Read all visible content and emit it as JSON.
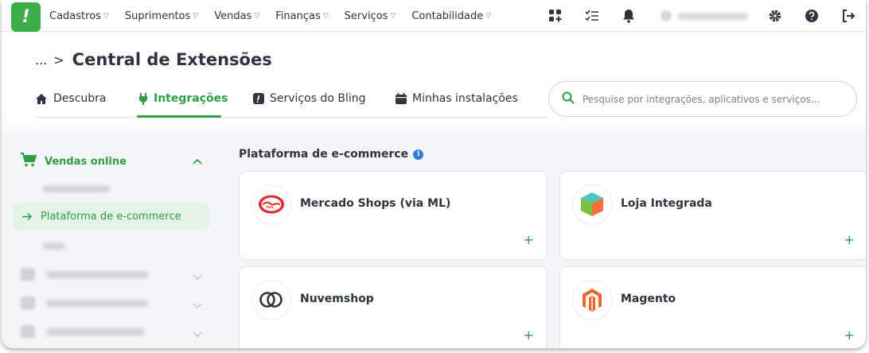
{
  "topnav": {
    "logo_glyph": "!",
    "menu": [
      {
        "label": "Cadastros"
      },
      {
        "label": "Suprimentos"
      },
      {
        "label": "Vendas"
      },
      {
        "label": "Finanças"
      },
      {
        "label": "Serviços"
      },
      {
        "label": "Contabilidade"
      }
    ],
    "icons": [
      "apps-plus-icon",
      "checklist-icon",
      "bell-icon",
      "gear-icon",
      "help-icon",
      "logout-icon"
    ]
  },
  "header": {
    "breadcrumb_ellipsis": "...",
    "breadcrumb_separator": ">",
    "title": "Central de Extensões",
    "tabs": [
      {
        "label": "Descubra",
        "icon": "home-icon"
      },
      {
        "label": "Integrações",
        "icon": "plug-icon",
        "active": true
      },
      {
        "label": "Serviços do Bling",
        "icon": "bling-icon"
      },
      {
        "label": "Minhas instalações",
        "icon": "calendar-icon"
      }
    ],
    "search": {
      "placeholder": "Pesquise por integrações, aplicativos e serviços..."
    }
  },
  "sidebar": {
    "group": {
      "label": "Vendas online",
      "icon": "cart-icon",
      "expanded": true
    },
    "active_item": {
      "label": "Plataforma de e-commerce",
      "icon": "arrow-right-icon"
    }
  },
  "main": {
    "section_title": "Plataforma de e-commerce",
    "section_info_glyph": "i",
    "add_glyph": "+",
    "cards": [
      {
        "name": "Mercado Shops (via ML)",
        "icon": "mercado-shops-logo-icon"
      },
      {
        "name": "Loja Integrada",
        "icon": "loja-integrada-logo-icon"
      },
      {
        "name": "Nuvemshop",
        "icon": "nuvemshop-logo-icon"
      },
      {
        "name": "Magento",
        "icon": "magento-logo-icon"
      }
    ]
  },
  "colors": {
    "brand_green": "#3bae4a",
    "active_green": "#2f9e44",
    "active_bg": "#e3f3e5",
    "info_blue": "#2f7ed8",
    "magento_orange": "#ee672f",
    "mercado_red": "#e3262b"
  }
}
